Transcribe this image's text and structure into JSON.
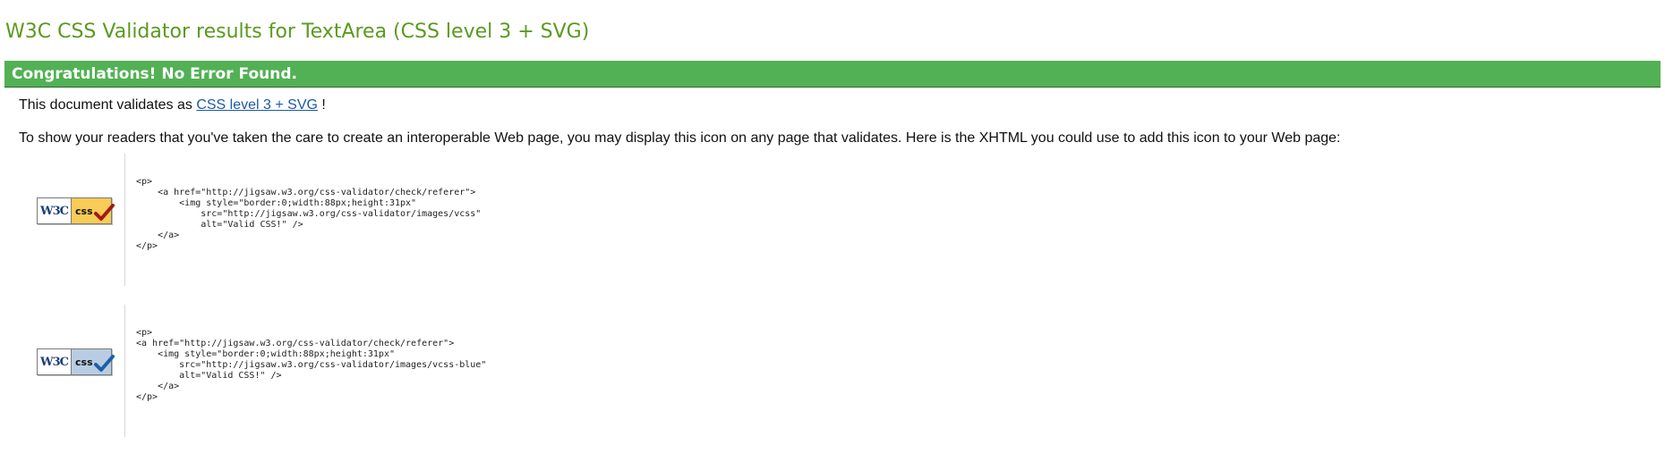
{
  "page": {
    "title": "W3C CSS Validator results for TextArea (CSS level 3 + SVG)"
  },
  "banner": {
    "text": "Congratulations! No Error Found.",
    "color": "#52b154"
  },
  "validates": {
    "prefix": "This document validates as ",
    "link_text": "CSS level 3 + SVG",
    "suffix": " !"
  },
  "icon_note": "To show your readers that you've taken the care to create an interoperable Web page, you may display this icon on any page that validates. Here is the XHTML you could use to add this icon to your Web page:",
  "badges": [
    {
      "icon": "w3c-css-valid-gold-badge-icon",
      "logo_text": "W3C",
      "label": "css",
      "accent": "#f9cb57",
      "check_color": "#a31a12",
      "code": "<p>\n    <a href=\"http://jigsaw.w3.org/css-validator/check/referer\">\n        <img style=\"border:0;width:88px;height:31px\"\n            src=\"http://jigsaw.w3.org/css-validator/images/vcss\"\n            alt=\"Valid CSS!\" />\n    </a>\n</p>"
    },
    {
      "icon": "w3c-css-valid-blue-badge-icon",
      "logo_text": "W3C",
      "label": "css",
      "accent": "#b8cde3",
      "check_color": "#1d5fa8",
      "code": "<p>\n<a href=\"http://jigsaw.w3.org/css-validator/check/referer\">\n    <img style=\"border:0;width:88px;height:31px\"\n        src=\"http://jigsaw.w3.org/css-validator/images/vcss-blue\"\n        alt=\"Valid CSS!\" />\n    </a>\n</p>"
    }
  ]
}
